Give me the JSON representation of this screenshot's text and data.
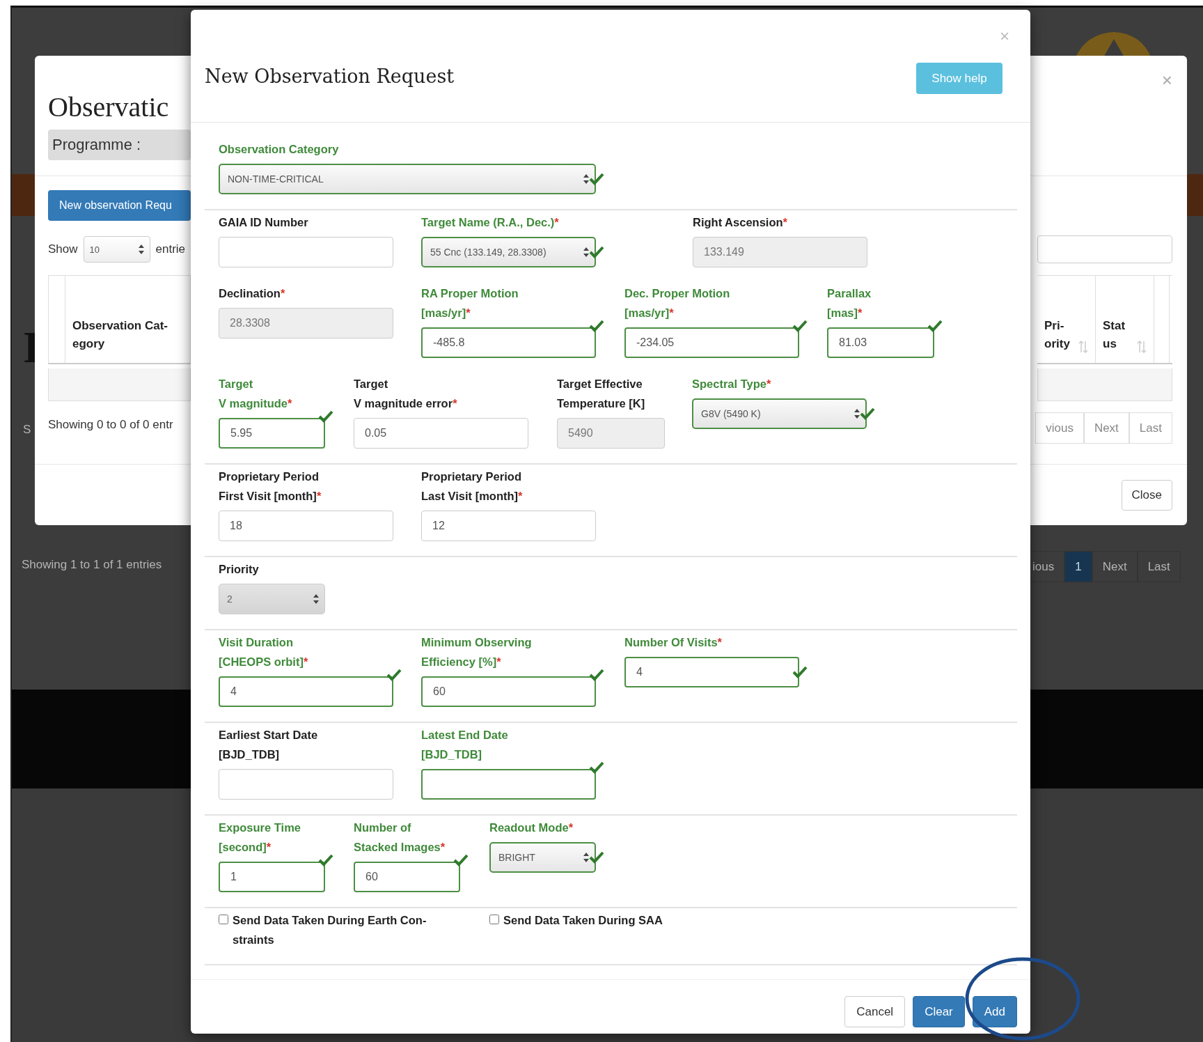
{
  "background_page": {
    "heading_fragment": "I",
    "text_fragment": "S",
    "info": "Showing 1 to 1 of 1 entries",
    "pagination": [
      {
        "label": "ious",
        "selected": false
      },
      {
        "label": "1",
        "selected": true
      },
      {
        "label": "Next",
        "selected": false
      },
      {
        "label": "Last",
        "selected": false
      }
    ]
  },
  "back_modal": {
    "title": "Observatic",
    "programme_label": "Programme :",
    "close_symbol": "×",
    "new_button": "New observation Requ",
    "show_label": "Show",
    "page_size": "10",
    "entries_label": "entrie",
    "columns_left": [
      {
        "label": "Observation Cat-\negory"
      }
    ],
    "columns_right": [
      {
        "label": "Pri-\nority"
      },
      {
        "label": "Stat\nus"
      }
    ],
    "info": "Showing 0 to 0 of 0 entr",
    "pagination": [
      "vious",
      "Next",
      "Last"
    ],
    "close_button": "Close"
  },
  "modal": {
    "title": "New Observation Request",
    "close_symbol": "×",
    "help_button": "Show help",
    "sections": [
      {
        "rows": [
          [
            {
              "kind": "select",
              "label": "Observation Category",
              "valid": true,
              "value": "NON-TIME-CRITICAL"
            }
          ]
        ]
      },
      {
        "rows": [
          [
            {
              "kind": "input",
              "label": "GAIA ID Number",
              "valid": false
            },
            {
              "kind": "select",
              "label": "Target Name (R.A., Dec.)",
              "marker": "*",
              "valid": true,
              "value": "55 Cnc (133.149, 28.3308)"
            },
            {
              "kind": "input",
              "label": "Right Ascension",
              "marker": "*",
              "valid": false,
              "disabled": true,
              "value": "133.149"
            }
          ],
          [
            {
              "kind": "input",
              "label": "Declination",
              "marker": "*",
              "valid": false,
              "disabled": true,
              "value": "28.3308"
            },
            {
              "kind": "input",
              "label": "RA Proper Motion\n[mas/yr]",
              "marker": "*",
              "valid": true,
              "value": "-485.8"
            },
            {
              "kind": "input",
              "label": "Dec. Proper Motion\n[mas/yr]",
              "marker": "*",
              "valid": true,
              "value": "-234.05"
            },
            {
              "kind": "input",
              "label": "Parallax\n[mas]",
              "marker": "*",
              "valid": true,
              "value": "81.03"
            }
          ],
          [
            {
              "kind": "input",
              "label": "Target\nV magnitude",
              "marker": "*",
              "valid": true,
              "value": "5.95"
            },
            {
              "kind": "input",
              "label": "Target\nV magnitude error",
              "marker": "*",
              "valid": false,
              "value": "0.05"
            },
            {
              "kind": "input",
              "label": "Target Effective\nTemperature [K]",
              "valid": false,
              "disabled": true,
              "value": "5490"
            },
            {
              "kind": "select",
              "label": "Spectral Type",
              "marker": "*",
              "valid": true,
              "value": "G8V (5490 K)"
            }
          ]
        ]
      },
      {
        "rows": [
          [
            {
              "kind": "input",
              "label": "Proprietary Period\nFirst Visit [month]",
              "marker": "*",
              "valid": false,
              "value": "18"
            },
            {
              "kind": "input",
              "label": "Proprietary Period\nLast Visit [month]",
              "marker": "*",
              "valid": false,
              "value": "12"
            }
          ]
        ]
      },
      {
        "rows": [
          [
            {
              "kind": "select",
              "label": "Priority",
              "valid": false,
              "disabled": true,
              "value": "2"
            }
          ]
        ]
      },
      {
        "rows": [
          [
            {
              "kind": "input",
              "label": "Visit Duration\n[CHEOPS orbit]",
              "marker": "*",
              "valid": true,
              "value": "4"
            },
            {
              "kind": "input",
              "label": "Minimum Observing\nEfficiency [%]",
              "marker": "*",
              "valid": true,
              "value": "60"
            },
            {
              "kind": "input",
              "label": "Number Of Visits",
              "marker": "*",
              "valid": true,
              "value": "4"
            }
          ]
        ]
      },
      {
        "rows": [
          [
            {
              "kind": "input",
              "label": "Earliest Start Date\n[BJD_TDB]",
              "valid": false
            },
            {
              "kind": "input",
              "label": "Latest End Date\n[BJD_TDB]",
              "valid": true
            }
          ]
        ]
      },
      {
        "rows": [
          [
            {
              "kind": "input",
              "label": "Exposure Time\n[second]",
              "marker": "*",
              "valid": true,
              "value": "1"
            },
            {
              "kind": "input",
              "label": "Number of\nStacked Images",
              "marker": "*",
              "valid": true,
              "value": "60"
            },
            {
              "kind": "select",
              "label": "Readout Mode",
              "marker": "*",
              "valid": true,
              "value": "BRIGHT"
            }
          ]
        ]
      },
      {
        "rows": [
          [
            {
              "kind": "checkbox",
              "label": "Send Data Taken During Earth Con-\nstraints",
              "checked": false
            },
            {
              "kind": "checkbox",
              "label": "Send Data Taken During SAA",
              "checked": false
            }
          ]
        ]
      }
    ],
    "buttons": [
      {
        "label": "Cancel",
        "kind": "default"
      },
      {
        "label": "Clear",
        "kind": "primary"
      },
      {
        "label": "Add",
        "kind": "primary"
      }
    ]
  }
}
